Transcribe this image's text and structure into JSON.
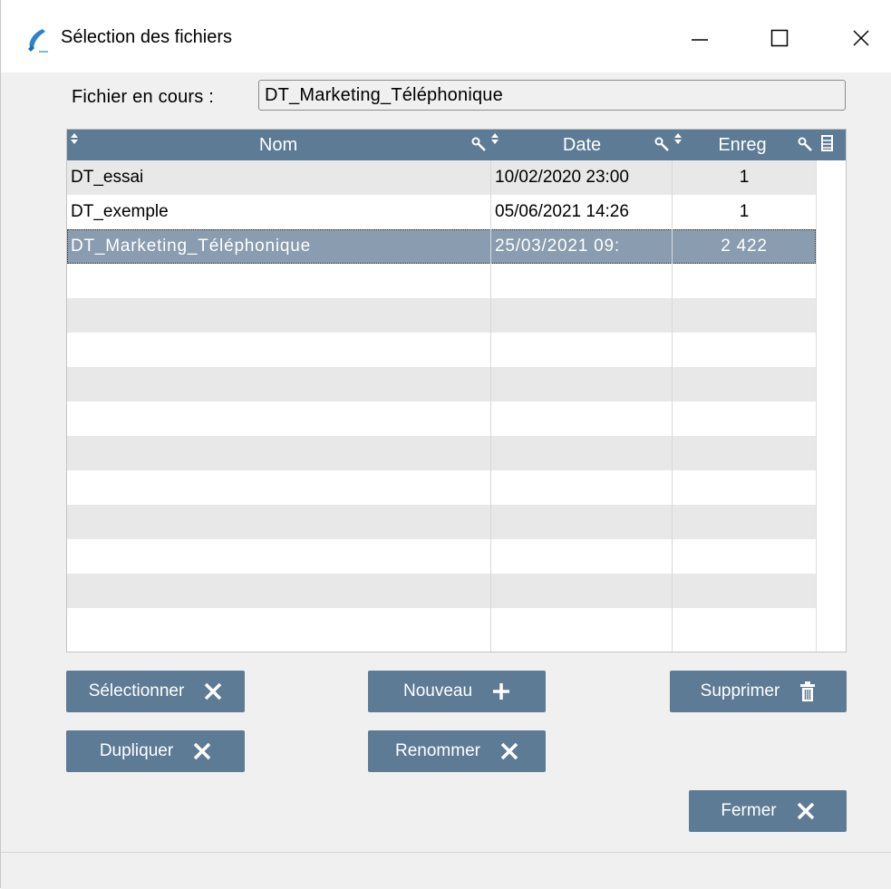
{
  "window": {
    "title": "Sélection des fichiers",
    "icon": "phone-handset-icon"
  },
  "current_file": {
    "label": "Fichier en cours :",
    "value": "DT_Marketing_Téléphonique"
  },
  "table": {
    "columns": [
      {
        "label": "Nom"
      },
      {
        "label": "Date"
      },
      {
        "label": "Enreg"
      }
    ],
    "rows": [
      {
        "name": "DT_essai",
        "date": "10/02/2020  23:00",
        "enreg": "1"
      },
      {
        "name": "DT_exemple",
        "date": "05/06/2021  14:26",
        "enreg": "1"
      },
      {
        "name": "DT_Marketing_Téléphonique",
        "date": "25/03/2021   09:",
        "enreg": "2 422",
        "selected": true
      }
    ],
    "empty_rows": 11
  },
  "buttons": {
    "select": "Sélectionner",
    "new": "Nouveau",
    "delete": "Supprimer",
    "duplicate": "Dupliquer",
    "rename": "Renommer",
    "close": "Fermer"
  },
  "colors": {
    "header": "#5d7b95",
    "button": "#5d7b95",
    "selected_row": "#8a9caf",
    "alt_row": "#e8e8e8"
  }
}
